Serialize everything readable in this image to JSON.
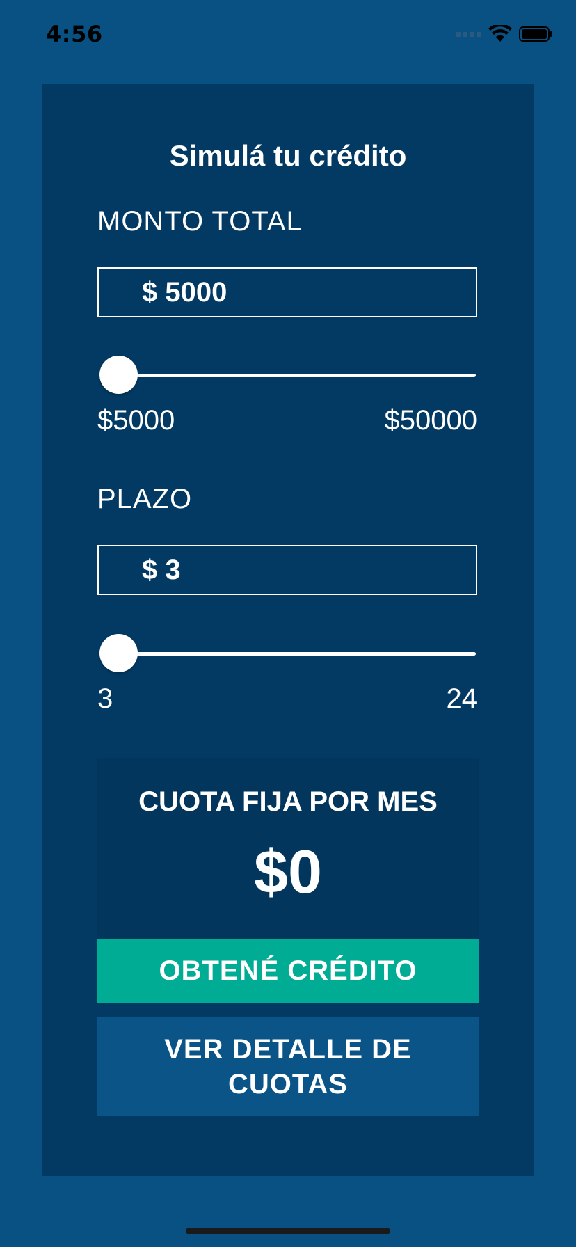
{
  "status_bar": {
    "time": "4:56"
  },
  "title": "Simulá tu crédito",
  "amount": {
    "label": "MONTO TOTAL",
    "value": "$ 5000",
    "min_label": "$5000",
    "max_label": "$50000",
    "slider_fraction": 0
  },
  "term": {
    "label": "PLAZO",
    "value": "$ 3",
    "min_label": "3",
    "max_label": "24",
    "slider_fraction": 0
  },
  "quota": {
    "label": "CUOTA FIJA POR MES",
    "value": "$0"
  },
  "buttons": {
    "get_credit": "OBTENÉ CRÉDITO",
    "view_details": "VER DETALLE DE CUOTAS"
  },
  "colors": {
    "background": "#0a5183",
    "card": "#033a63",
    "accent": "#00ac93",
    "secondary_button": "#0a5487"
  },
  "icons": [
    "signal-icon",
    "wifi-icon",
    "battery-icon"
  ]
}
